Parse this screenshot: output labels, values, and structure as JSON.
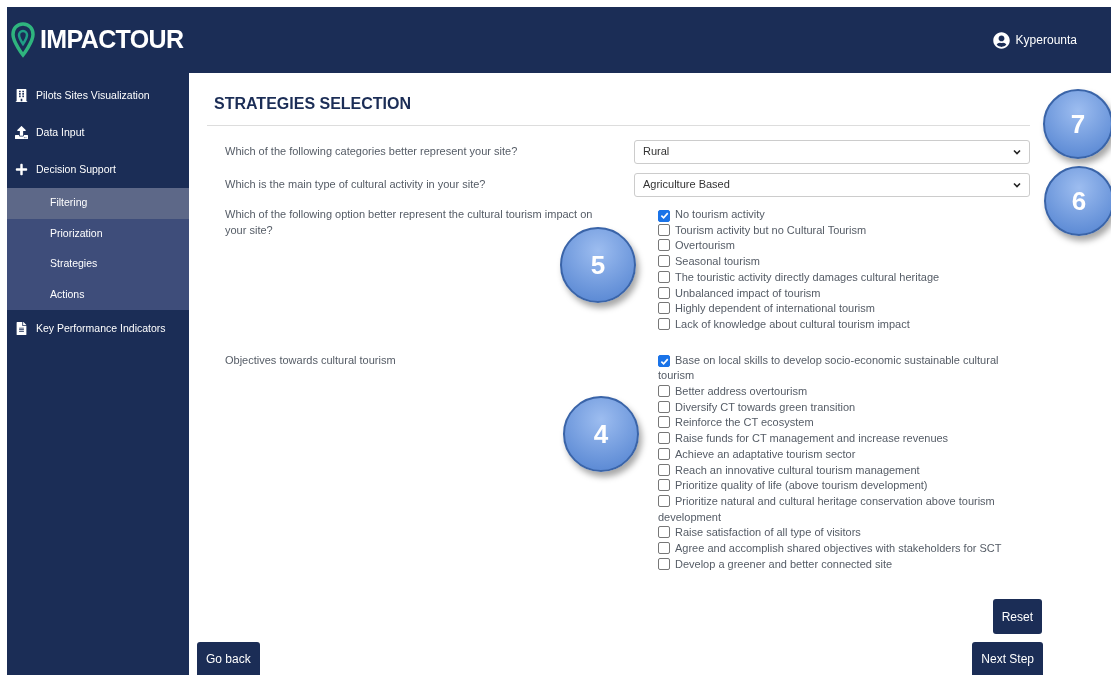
{
  "header": {
    "logo_text": "IMPACTOUR",
    "user": "Kyperounta"
  },
  "sidebar": {
    "items": [
      {
        "label": "Pilots Sites Visualization",
        "selected": false
      },
      {
        "label": "Data Input",
        "selected": false
      },
      {
        "label": "Decision Support",
        "selected": false,
        "expanded": true,
        "children": [
          {
            "label": "Filtering",
            "selected": true
          },
          {
            "label": "Priorization",
            "selected": false
          },
          {
            "label": "Strategies",
            "selected": false
          },
          {
            "label": "Actions",
            "selected": false
          }
        ]
      },
      {
        "label": "Key Performance Indicators",
        "selected": false
      }
    ]
  },
  "page_title": "STRATEGIES SELECTION",
  "questions": [
    {
      "kind": "select",
      "label": "Which of the following categories better represent your site?",
      "value": "Rural"
    },
    {
      "kind": "select",
      "label": "Which is the main type of cultural activity in your site?",
      "value": "Agriculture Based"
    },
    {
      "kind": "checklist",
      "label": "Which of the following option better represent the cultural tourism impact on your site?",
      "options": [
        {
          "label": "No tourism activity",
          "checked": true
        },
        {
          "label": "Tourism activity but no Cultural Tourism",
          "checked": false
        },
        {
          "label": "Overtourism",
          "checked": false
        },
        {
          "label": "Seasonal tourism",
          "checked": false
        },
        {
          "label": "The touristic activity directly damages cultural heritage",
          "checked": false
        },
        {
          "label": "Unbalanced impact of tourism",
          "checked": false
        },
        {
          "label": "Highly dependent of international tourism",
          "checked": false
        },
        {
          "label": "Lack of knowledge about cultural tourism impact",
          "checked": false
        }
      ]
    },
    {
      "kind": "checklist",
      "label": "Objectives towards cultural tourism",
      "options": [
        {
          "label": "Base on local skills to develop socio-economic sustainable cultural tourism",
          "checked": true
        },
        {
          "label": "Better address overtourism",
          "checked": false
        },
        {
          "label": "Diversify CT towards green transition",
          "checked": false
        },
        {
          "label": "Reinforce the CT ecosystem",
          "checked": false
        },
        {
          "label": "Raise funds for CT management and increase revenues",
          "checked": false
        },
        {
          "label": "Achieve an adaptative tourism sector",
          "checked": false
        },
        {
          "label": "Reach an innovative cultural tourism management",
          "checked": false
        },
        {
          "label": "Prioritize quality of life (above tourism development)",
          "checked": false
        },
        {
          "label": "Prioritize natural and cultural heritage conservation above tourism development",
          "checked": false
        },
        {
          "label": "Raise satisfaction of all type of visitors",
          "checked": false
        },
        {
          "label": "Agree and accomplish shared objectives with stakeholders for SCT",
          "checked": false
        },
        {
          "label": "Develop a greener and better connected site",
          "checked": false
        }
      ]
    }
  ],
  "buttons": {
    "reset": "Reset",
    "back": "Go back",
    "next": "Next Step"
  },
  "callouts": [
    {
      "label": "7"
    },
    {
      "label": "6"
    },
    {
      "label": "5"
    },
    {
      "label": "4"
    }
  ]
}
